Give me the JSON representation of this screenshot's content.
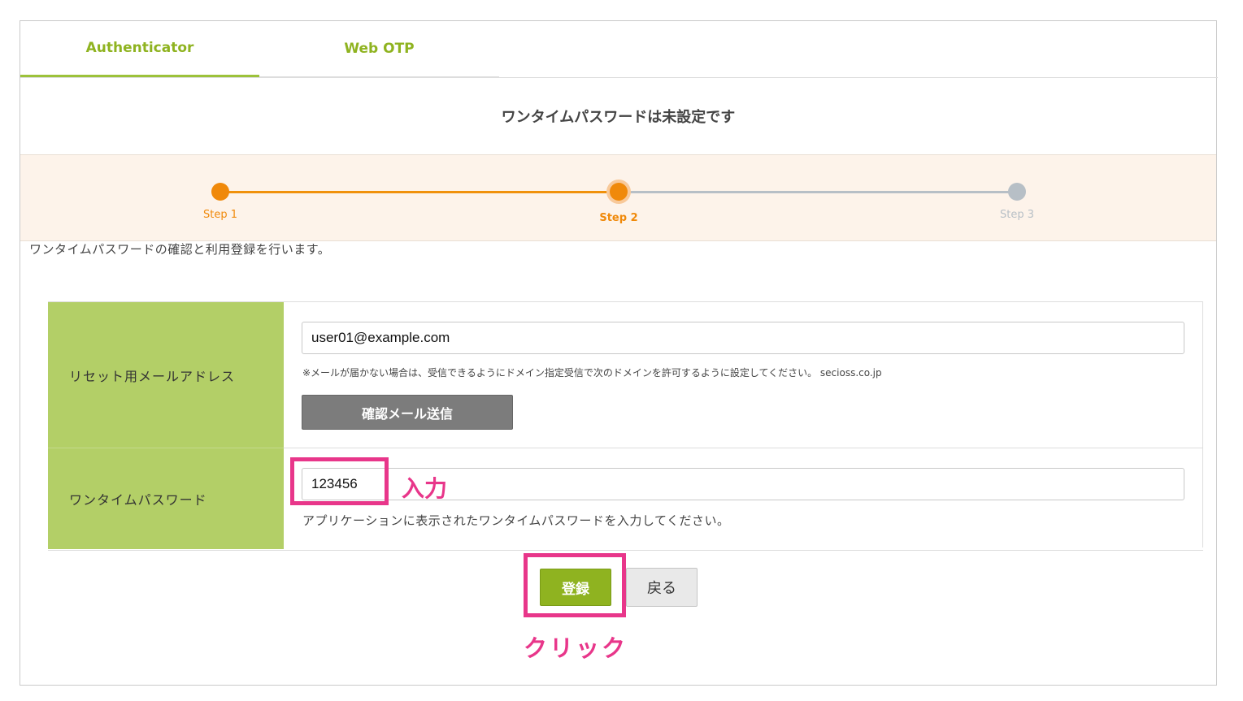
{
  "tabs": [
    {
      "label": "Authenticator",
      "active": true
    },
    {
      "label": "Web OTP",
      "active": false
    }
  ],
  "status_title": "ワンタイムパスワードは未設定です",
  "steps": {
    "items": [
      "Step 1",
      "Step 2",
      "Step 3"
    ],
    "current": 2
  },
  "intro": "ワンタイムパスワードの確認と利用登録を行います。",
  "form": {
    "email_label": "リセット用メールアドレス",
    "email_value": "user01@example.com",
    "email_note": "※メールが届かない場合は、受信できるようにドメイン指定受信で次のドメインを許可するように設定してください。 secioss.co.jp",
    "send_button": "確認メール送信",
    "otp_label": "ワンタイムパスワード",
    "otp_value": "123456",
    "otp_help": "アプリケーションに表示されたワンタイムパスワードを入力してください。"
  },
  "buttons": {
    "register": "登録",
    "back": "戻る"
  },
  "annotations": {
    "input": "入力",
    "click": "クリック",
    "color": "#e8368a"
  },
  "colors": {
    "accent_green": "#8fb320",
    "label_bg": "#b3cf67",
    "step_active": "#f0890a",
    "step_inactive": "#b7bfc6"
  }
}
